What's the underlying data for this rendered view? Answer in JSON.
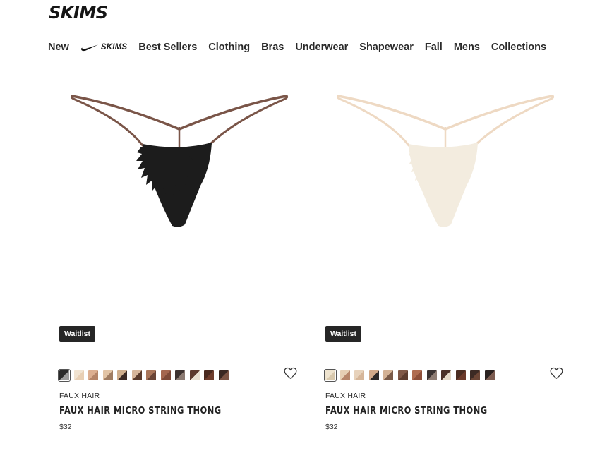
{
  "header": {
    "logo_text": "SKIMS",
    "nav": [
      {
        "label": "New"
      },
      {
        "label": "SKIMS",
        "collab": true,
        "icon": "swoosh-icon"
      },
      {
        "label": "Best Sellers"
      },
      {
        "label": "Clothing"
      },
      {
        "label": "Bras"
      },
      {
        "label": "Underwear"
      },
      {
        "label": "Shapewear"
      },
      {
        "label": "Fall"
      },
      {
        "label": "Mens"
      },
      {
        "label": "Collections"
      }
    ]
  },
  "products": [
    {
      "badge": "Waitlist",
      "brand": "FAUX HAIR",
      "title": "FAUX HAIR MICRO STRING THONG",
      "price": "$32",
      "strap_color": "#7a5548",
      "tuft_color": "#1c1c1c",
      "swatches": [
        [
          "#2b2b2b",
          "#9c9c9c"
        ],
        [
          "#f1e3d1",
          "#e8cfb4"
        ],
        [
          "#dcae90",
          "#b58468"
        ],
        [
          "#e2c4a5",
          "#a07d62"
        ],
        [
          "#cfae8c",
          "#3b2a24"
        ],
        [
          "#d7b69a",
          "#5a3a2b"
        ],
        [
          "#a97559",
          "#6a4536"
        ],
        [
          "#a4664f",
          "#7e4938"
        ],
        [
          "#3d3230",
          "#8b7a72"
        ],
        [
          "#5d3a2e",
          "#e9dfd1"
        ],
        [
          "#4a2a20",
          "#6f3d2d"
        ],
        [
          "#3a2822",
          "#7c5444"
        ]
      ],
      "selected_swatch": 0
    },
    {
      "badge": "Waitlist",
      "brand": "FAUX HAIR",
      "title": "FAUX HAIR MICRO STRING THONG",
      "price": "$32",
      "strap_color": "#eed9c3",
      "tuft_color": "#f3ecdf",
      "swatches": [
        [
          "#efe4cf",
          "#d9c9ad"
        ],
        [
          "#e6cfb4",
          "#b7866a"
        ],
        [
          "#e7d2bb",
          "#d6b699"
        ],
        [
          "#d2a988",
          "#2e2a28"
        ],
        [
          "#d4b295",
          "#7a5b49"
        ],
        [
          "#7f5847",
          "#5c3c2f"
        ],
        [
          "#b06d51",
          "#8e503a"
        ],
        [
          "#3a3332",
          "#8e7d74"
        ],
        [
          "#4a3128",
          "#e4d9c8"
        ],
        [
          "#4b2d22",
          "#6c3a2a"
        ],
        [
          "#3b2a24",
          "#6a4535"
        ],
        [
          "#2a2220",
          "#7c5c50"
        ]
      ],
      "selected_swatch": 0
    }
  ]
}
